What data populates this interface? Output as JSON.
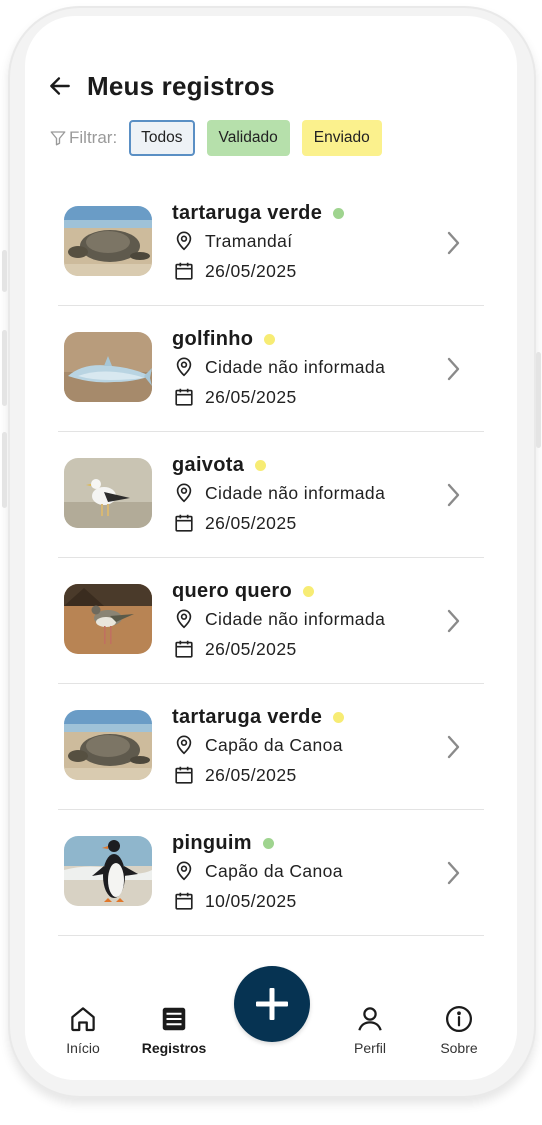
{
  "header": {
    "title": "Meus registros",
    "back_icon": "arrow-left-icon"
  },
  "filter": {
    "label": "Filtrar:",
    "icon": "filter-icon",
    "chips": [
      {
        "label": "Todos",
        "selected": true,
        "color": "#5a8fc4"
      },
      {
        "label": "Validado",
        "selected": false,
        "color": "#b6e0ab"
      },
      {
        "label": "Enviado",
        "selected": false,
        "color": "#fbf18d"
      }
    ]
  },
  "colors": {
    "validado": "#9fd48f",
    "enviado": "#f7ec74",
    "fab": "#063352"
  },
  "records": [
    {
      "species": "tartaruga verde",
      "city": "Tramandaí",
      "date": "26/05/2025",
      "status": "validado",
      "image": "turtle-photo"
    },
    {
      "species": "golfinho",
      "city": "Cidade não informada",
      "date": "26/05/2025",
      "status": "enviado",
      "image": "dolphin-photo"
    },
    {
      "species": "gaivota",
      "city": "Cidade não informada",
      "date": "26/05/2025",
      "status": "enviado",
      "image": "gull-photo"
    },
    {
      "species": "quero quero",
      "city": "Cidade não informada",
      "date": "26/05/2025",
      "status": "enviado",
      "image": "lapwing-photo"
    },
    {
      "species": "tartaruga verde",
      "city": "Capão da Canoa",
      "date": "26/05/2025",
      "status": "enviado",
      "image": "turtle-photo"
    },
    {
      "species": "pinguim",
      "city": "Capão da Canoa",
      "date": "10/05/2025",
      "status": "validado",
      "image": "penguin-photo"
    }
  ],
  "nav": {
    "items": [
      {
        "label": "Início",
        "icon": "home-icon",
        "active": false
      },
      {
        "label": "Registros",
        "icon": "list-icon",
        "active": true
      },
      {
        "label": "Perfil",
        "icon": "user-icon",
        "active": false
      },
      {
        "label": "Sobre",
        "icon": "info-icon",
        "active": false
      }
    ],
    "fab_icon": "plus-icon"
  }
}
